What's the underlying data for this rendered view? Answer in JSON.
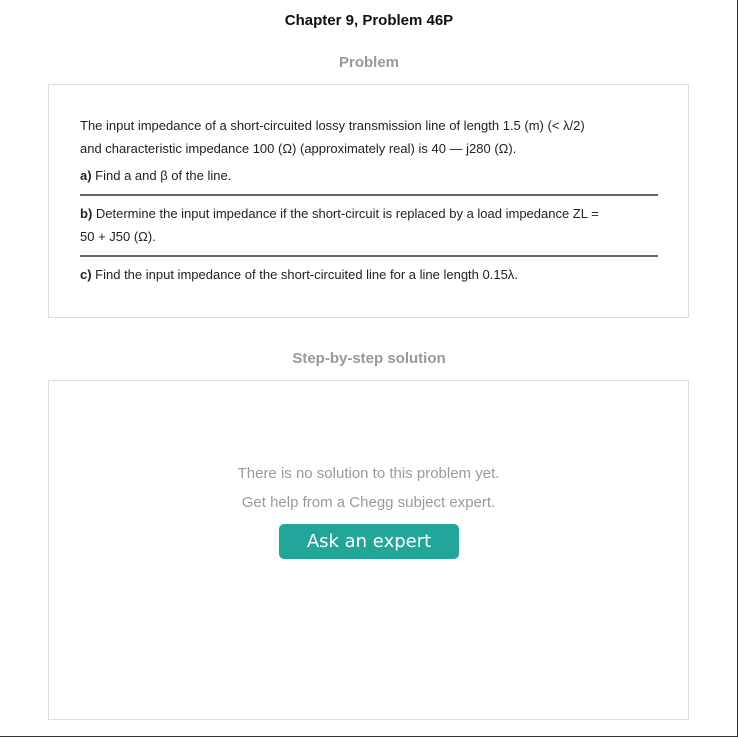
{
  "chapter_title": "Chapter 9, Problem 46P",
  "problem": {
    "heading": "Problem",
    "intro_line1": "The input impedance of a short-circuited lossy transmission line of length 1.5 (m) (< λ/2)",
    "intro_line2": "and characteristic impedance 100 (Ω) (approximately real) is 40 — j280 (Ω).",
    "parts": [
      {
        "label": "a)",
        "text": " Find a and β of the line."
      },
      {
        "label": "b)",
        "text_line1": " Determine the input impedance if the short-circuit is replaced by a load impedance ZL =",
        "text_line2": "50 + J50 (Ω)."
      },
      {
        "label": "c)",
        "text": " Find the input impedance of the short-circuited line for a line length 0.15λ."
      }
    ]
  },
  "solution": {
    "heading": "Step-by-step solution",
    "no_solution_line1": "There is no solution to this problem yet.",
    "no_solution_line2": "Get help from a Chegg subject expert.",
    "ask_button_label": "Ask an expert"
  },
  "colors": {
    "button": "#22a699",
    "heading_gray": "#999999",
    "card_border": "#dddddd"
  }
}
